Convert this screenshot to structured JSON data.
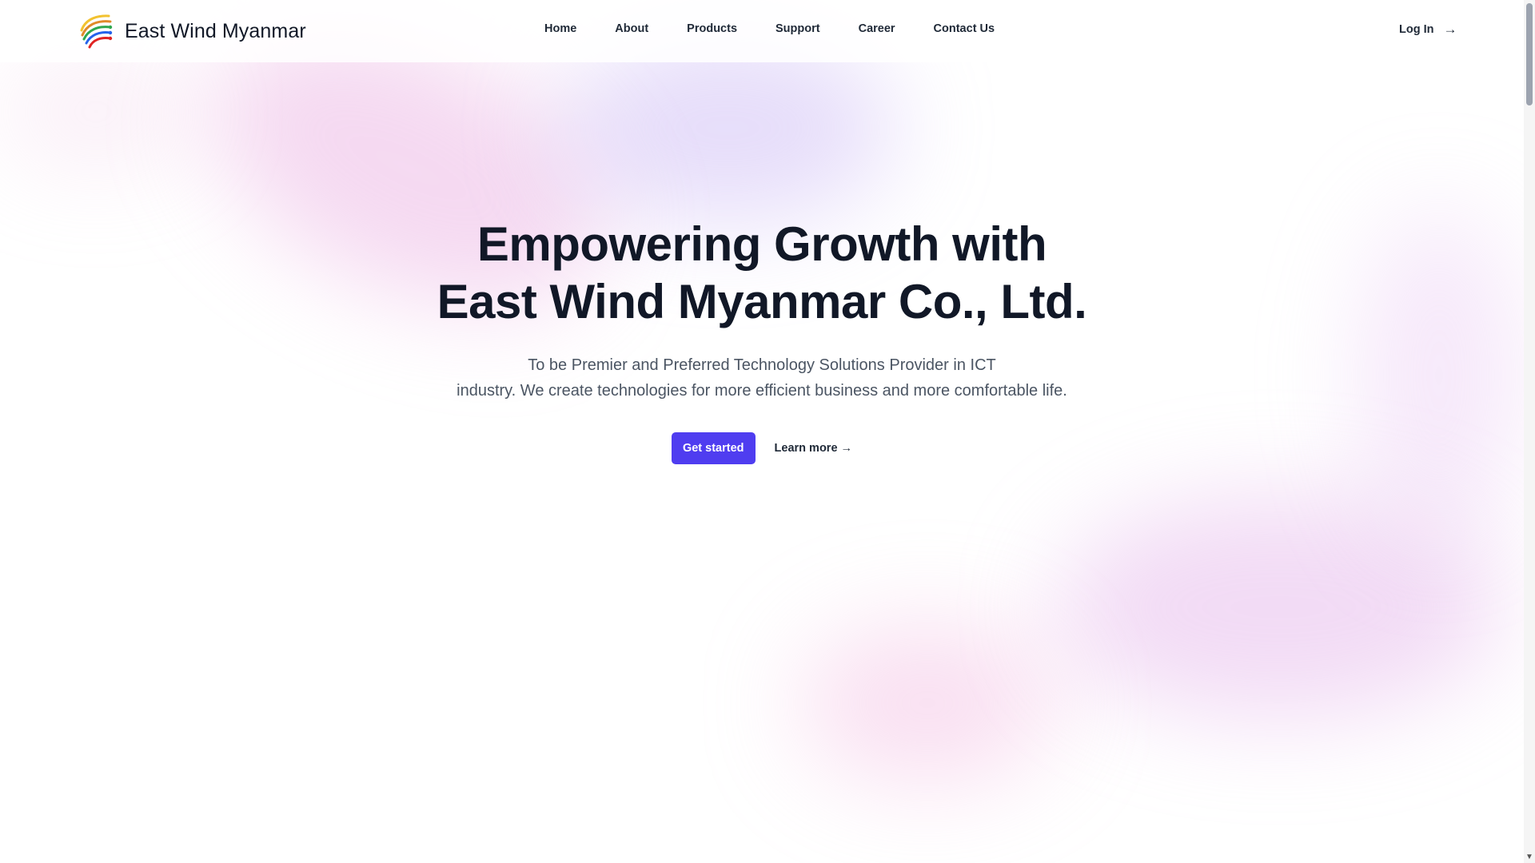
{
  "header": {
    "brand_name": "East Wind Myanmar",
    "nav": [
      {
        "label": "Home"
      },
      {
        "label": "About"
      },
      {
        "label": "Products"
      },
      {
        "label": "Support"
      },
      {
        "label": "Career"
      },
      {
        "label": "Contact Us"
      }
    ],
    "login_label": "Log In",
    "login_icon": "arrow-right-icon"
  },
  "hero": {
    "title_line1": "Empowering Growth with",
    "title_line2": "East Wind Myanmar Co., Ltd.",
    "subtitle_line1": "To be Premier and Preferred Technology Solutions Provider in ICT",
    "subtitle_line2": "industry. We create technologies for more efficient business and more comfortable life.",
    "primary_cta": "Get started",
    "secondary_cta": "Learn more →"
  },
  "colors": {
    "accent": "#4f3df0",
    "text_dark": "#111827",
    "text_muted": "#4b5563"
  }
}
